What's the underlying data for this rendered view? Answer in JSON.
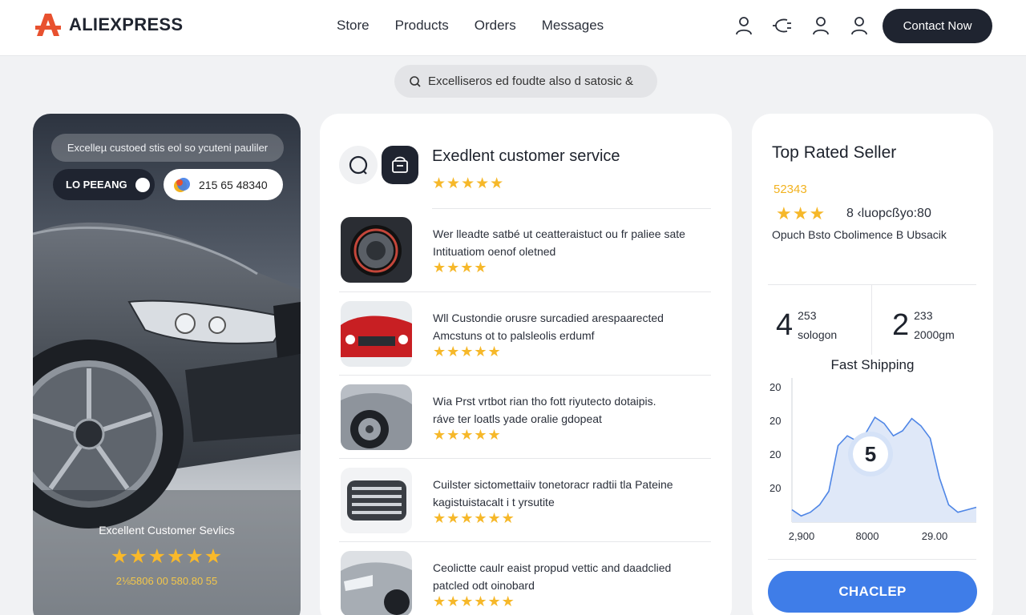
{
  "brand": {
    "name": "ALIEXPRESS",
    "logo_color": "#e8512f"
  },
  "nav": {
    "items": [
      "Store",
      "Products",
      "Orders",
      "Messages"
    ]
  },
  "header": {
    "icons": [
      "user-icon",
      "plug-icon",
      "user-icon",
      "user-icon"
    ],
    "contact_label": "Contact Now"
  },
  "search": {
    "text": "Excelliseros ed foudte also d satosic &"
  },
  "hero": {
    "pill_text": "Excelleµ custoed stis eol so ycuteni pauliler",
    "button_label": "LO PEEANG",
    "phone_text": "215 65 48340",
    "caption": "Excellent Customer Sevlics",
    "stars": "★★★★★★",
    "number_line": "2⅛5806 00 580.80 55"
  },
  "reviews_card": {
    "title": "Exedlent customer service",
    "title_stars": "★★★★★",
    "reviews": [
      {
        "line1": "Wer lleadte satbé ut ceatteraistuct ou fr paliee sate",
        "line2": "Intituatiom oenof oletned",
        "stars": "★★★★"
      },
      {
        "line1": "Wll Custondie orusre surcadied arespaarected",
        "line2": "Amcstuns ot to palsleolis erdumf",
        "stars": "★★★★★"
      },
      {
        "line1": "Wia Prst vrtbot rian tho fott riyutecto dotaipis.",
        "line2": "ráve ter loatls yade oralie gdopeat",
        "stars": "★★★★★"
      },
      {
        "line1": "Cuilster sictomettaiiv tonetoracr radtii tla Pateine",
        "line2": "kagistuistacalt i t yrsutite",
        "stars": "★★★★★★"
      },
      {
        "line1": "Ceolictte caulr eaist propud vettic and daadclied",
        "line2": "patcled odt oinobard",
        "stars": "★★★★★★"
      }
    ]
  },
  "seller_card": {
    "title": "Top Rated Seller",
    "rating_number": "52343",
    "stars": "★★★",
    "stars_text": "8 ‹luopcßyo:80",
    "subtitle": "Opuch Bsto Cbolimence B Ubsacik",
    "stat_left": {
      "big": "4",
      "top": "253",
      "bottom": "sologon"
    },
    "stat_right": {
      "big": "2",
      "top": "233",
      "bottom": "2000gm"
    },
    "shipping_label": "Fast Shipping",
    "chart_badge": "5",
    "action_label": "CHACLEP"
  },
  "chart_data": {
    "type": "area",
    "title": "Fast Shipping",
    "y_tick_labels": [
      "20",
      "20",
      "20",
      "20"
    ],
    "x_tick_labels": [
      "2,900",
      "8000",
      "29.00"
    ],
    "x": [
      0,
      1,
      2,
      3,
      4,
      5,
      6,
      7,
      8,
      9,
      10,
      11,
      12,
      13,
      14,
      15,
      16,
      17,
      18,
      19,
      20
    ],
    "values": [
      0.1,
      0.05,
      0.08,
      0.14,
      0.25,
      0.62,
      0.7,
      0.66,
      0.72,
      0.85,
      0.8,
      0.7,
      0.74,
      0.84,
      0.78,
      0.68,
      0.36,
      0.14,
      0.08,
      0.1,
      0.12
    ],
    "ylim": [
      0,
      1
    ],
    "grid": false,
    "colors": {
      "fill": "#dfe8f8",
      "line": "#4f86e6"
    }
  }
}
